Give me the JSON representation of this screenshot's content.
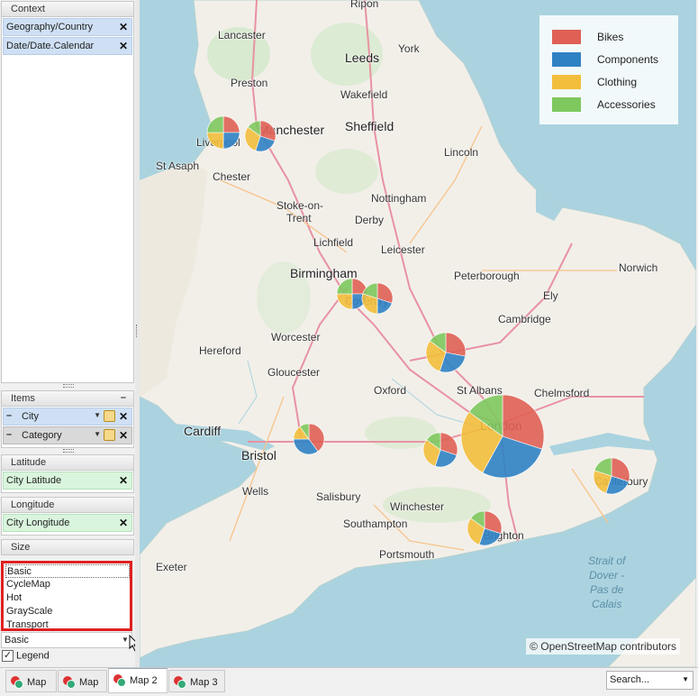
{
  "context": {
    "header": "Context",
    "fields": [
      "Geography/Country",
      "Date/Date.Calendar"
    ]
  },
  "items": {
    "header": "Items",
    "collapse_glyph": "–",
    "fields": [
      "City",
      "Category"
    ]
  },
  "latitude": {
    "header": "Latitude",
    "field": "City Latitude"
  },
  "longitude": {
    "header": "Longitude",
    "field": "City Longitude"
  },
  "size": {
    "header": "Size"
  },
  "map_style": {
    "options": [
      "Basic",
      "CycleMap",
      "Hot",
      "GrayScale",
      "Transport"
    ],
    "selected": "Basic"
  },
  "legend_checkbox": {
    "label": "Legend",
    "checked": true
  },
  "map": {
    "legend": [
      {
        "label": "Bikes",
        "color": "#e06055"
      },
      {
        "label": "Components",
        "color": "#2f82c4"
      },
      {
        "label": "Clothing",
        "color": "#f2be3c"
      },
      {
        "label": "Accessories",
        "color": "#7ec85e"
      }
    ],
    "attribution": "© OpenStreetMap contributors",
    "places": [
      "Ripon",
      "Lancaster",
      "Leeds",
      "York",
      "Preston",
      "Wakefield",
      "Manchester",
      "Sheffield",
      "Liverpool",
      "St Asaph",
      "Chester",
      "Lincoln",
      "Nottingham",
      "Stoke-on-",
      "Trent",
      "Derby",
      "Lichfield",
      "Leicester",
      "Birmingham",
      "Norwich",
      "Peterborough",
      "Ely",
      "Coventry",
      "Cambridge",
      "Worcester",
      "Hereford",
      "Gloucester",
      "St Albans",
      "Chelmsford",
      "Oxford",
      "Cardiff",
      "London",
      "Bristol",
      "Wells",
      "Salisbury",
      "Canterbury",
      "Winchester",
      "Southampton",
      "Brighton",
      "Portsmouth",
      "Exeter"
    ],
    "sea_label": [
      "Strait of",
      "Dover -",
      "Pas de",
      "Calais"
    ]
  },
  "tabs": [
    "Map",
    "Map",
    "Map 2",
    "Map 3"
  ],
  "active_tab": "Map 2",
  "search": {
    "placeholder": "Search..."
  }
}
